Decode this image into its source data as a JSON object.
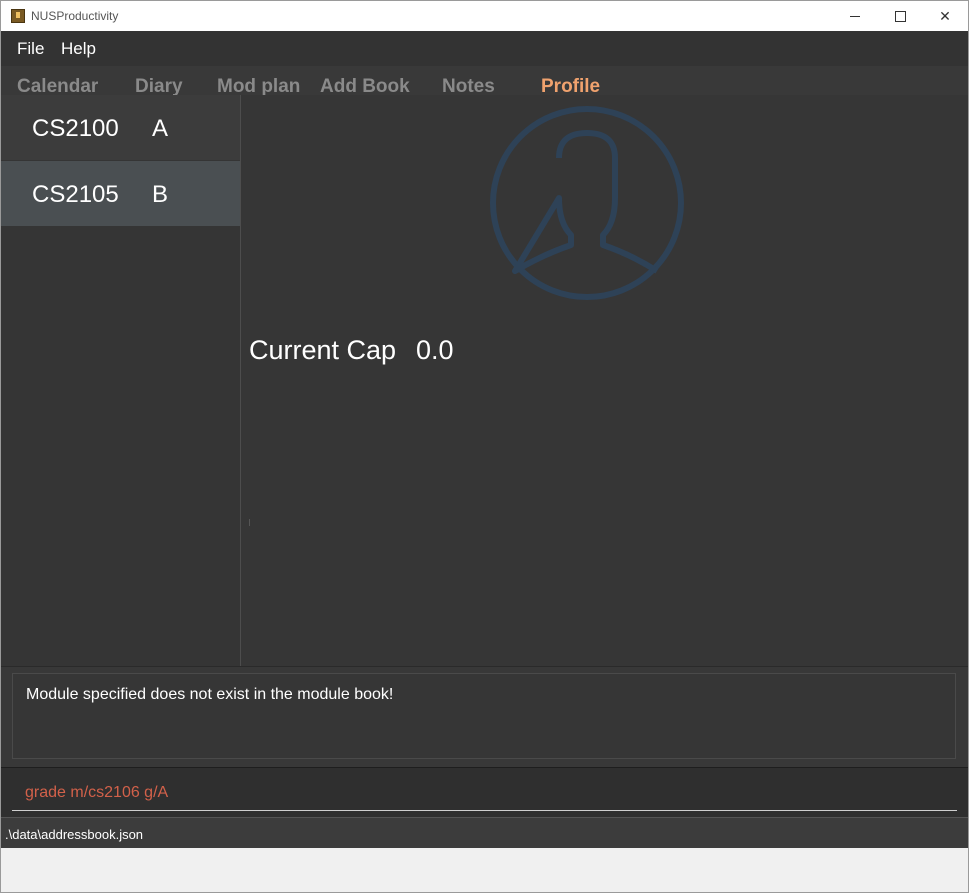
{
  "window": {
    "title": "NUSProductivity"
  },
  "menu": {
    "items": [
      {
        "label": "File"
      },
      {
        "label": "Help"
      }
    ]
  },
  "tabs": [
    {
      "label": "Calendar",
      "active": false
    },
    {
      "label": "Diary",
      "active": false
    },
    {
      "label": "Mod plan",
      "active": false
    },
    {
      "label": "Add Book",
      "active": false
    },
    {
      "label": "Notes",
      "active": false
    },
    {
      "label": "Profile",
      "active": true
    }
  ],
  "modules": [
    {
      "code": "CS2100",
      "grade": "A"
    },
    {
      "code": "CS2105",
      "grade": "B"
    }
  ],
  "profile": {
    "cap_label": "Current Cap",
    "cap_value": "0.0",
    "avatar_icon": "user-avatar-icon",
    "avatar_color": "#2e4257"
  },
  "result": {
    "message": "Module specified does not exist in the module book!"
  },
  "command": {
    "value": "grade m/cs2106 g/A",
    "error_color": "#d2614a"
  },
  "status": {
    "path": ".\\data\\addressbook.json"
  },
  "colors": {
    "active_tab": "#f0a26e",
    "inactive_tab": "#8a8a8a",
    "background": "#363636"
  }
}
